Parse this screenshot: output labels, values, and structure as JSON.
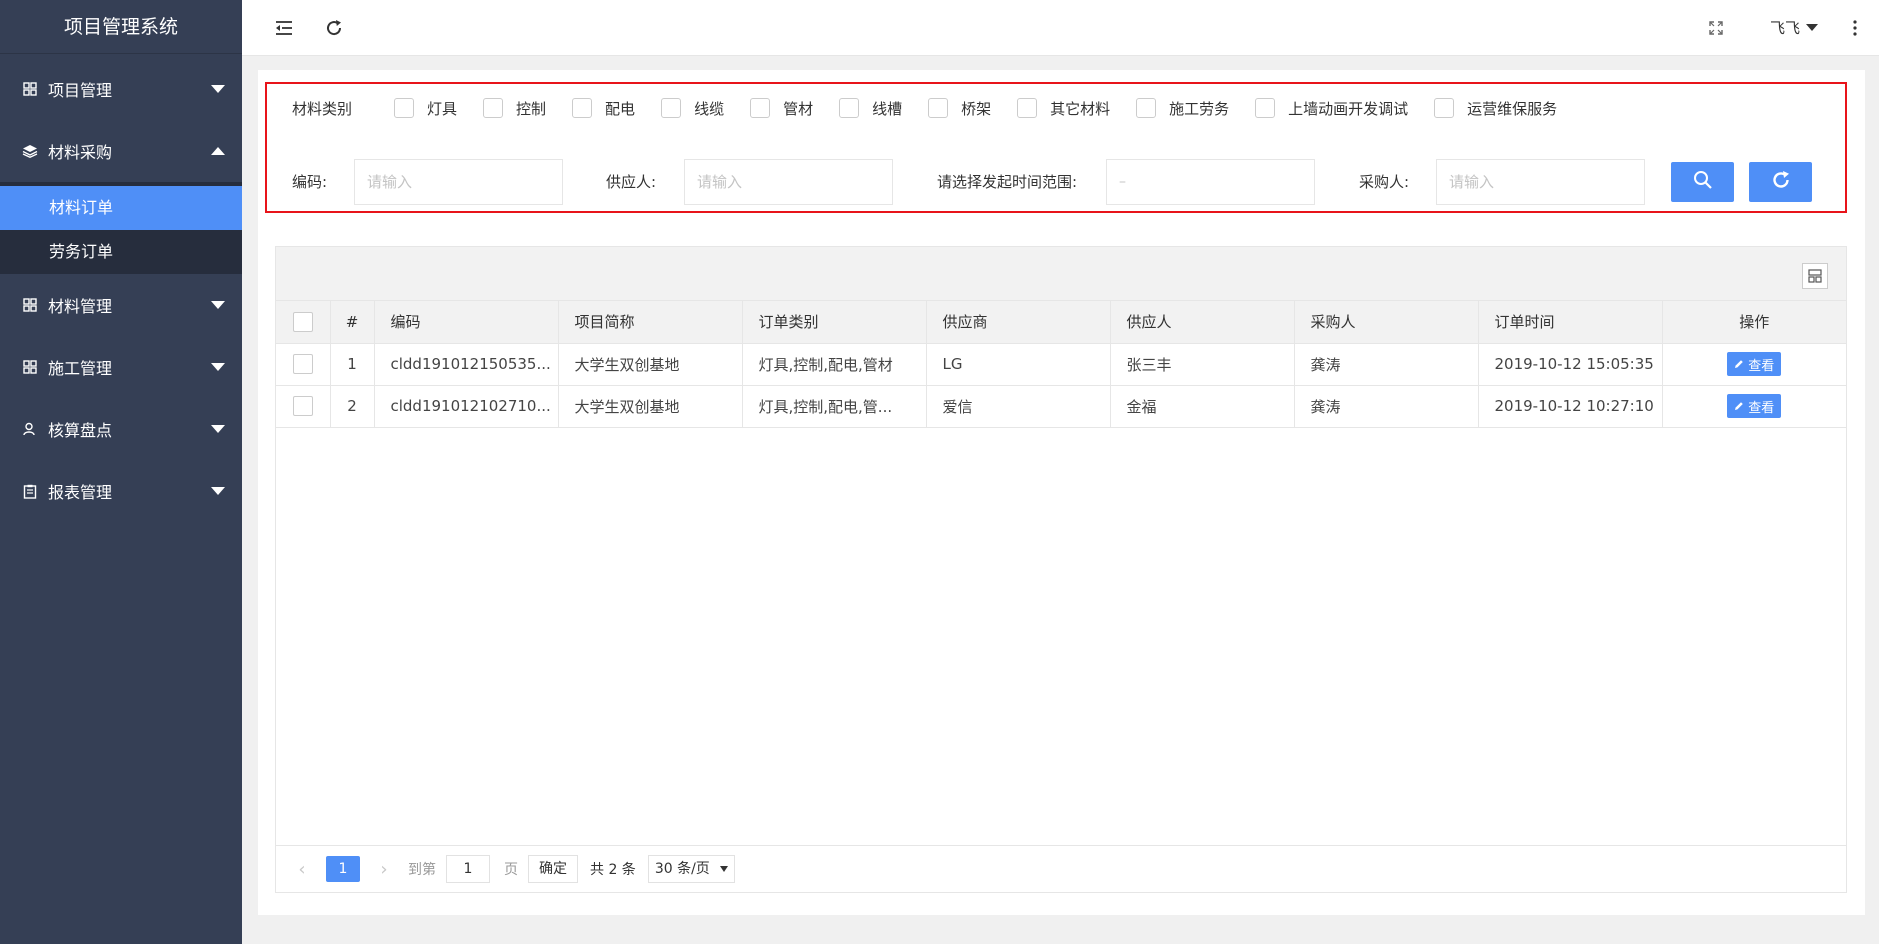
{
  "app": {
    "title": "项目管理系统"
  },
  "sidebar": {
    "items": [
      {
        "label": "项目管理",
        "icon": "grid-plus-icon",
        "expanded": false
      },
      {
        "label": "材料采购",
        "icon": "layers-icon",
        "expanded": true,
        "children": [
          {
            "label": "材料订单",
            "active": true
          },
          {
            "label": "劳务订单",
            "active": false
          }
        ]
      },
      {
        "label": "材料管理",
        "icon": "grid-plus-icon",
        "expanded": false
      },
      {
        "label": "施工管理",
        "icon": "grid-plus-icon",
        "expanded": false
      },
      {
        "label": "核算盘点",
        "icon": "user-icon",
        "expanded": false
      },
      {
        "label": "报表管理",
        "icon": "clipboard-icon",
        "expanded": false
      }
    ]
  },
  "header": {
    "user_name": "飞飞"
  },
  "filters": {
    "category_label": "材料类别",
    "categories": [
      "灯具",
      "控制",
      "配电",
      "线缆",
      "管材",
      "线槽",
      "桥架",
      "其它材料",
      "施工劳务",
      "上墙动画开发调试",
      "运营维保服务"
    ],
    "code_label": "编码:",
    "code_placeholder": "请输入",
    "supplier_person_label": "供应人:",
    "supplier_person_placeholder": "请输入",
    "time_range_label": "请选择发起时间范围:",
    "time_range_value": "–",
    "buyer_label": "采购人:",
    "buyer_placeholder": "请输入"
  },
  "table": {
    "columns": [
      "#",
      "编码",
      "项目简称",
      "订单类别",
      "供应商",
      "供应人",
      "采购人",
      "订单时间",
      "操作"
    ],
    "rows": [
      {
        "index": "1",
        "code": "cldd191012150535...",
        "project": "大学生双创基地",
        "category": "灯具,控制,配电,管材",
        "supplier": "LG",
        "supplier_person": "张三丰",
        "buyer": "龚涛",
        "time": "2019-10-12 15:05:35",
        "action": "查看"
      },
      {
        "index": "2",
        "code": "cldd191012102710...",
        "project": "大学生双创基地",
        "category": "灯具,控制,配电,管...",
        "supplier": "爱信",
        "supplier_person": "金福",
        "buyer": "龚涛",
        "time": "2019-10-12 10:27:10",
        "action": "查看"
      }
    ]
  },
  "pagination": {
    "current_page": "1",
    "goto_label": "到第",
    "goto_value": "1",
    "page_suffix": "页",
    "confirm_label": "确定",
    "total_text": "共 2 条",
    "page_size": "30 条/页"
  },
  "colors": {
    "sidebar_bg": "#353f55",
    "accent": "#4f8ff7",
    "highlight_border": "#e8141a"
  }
}
